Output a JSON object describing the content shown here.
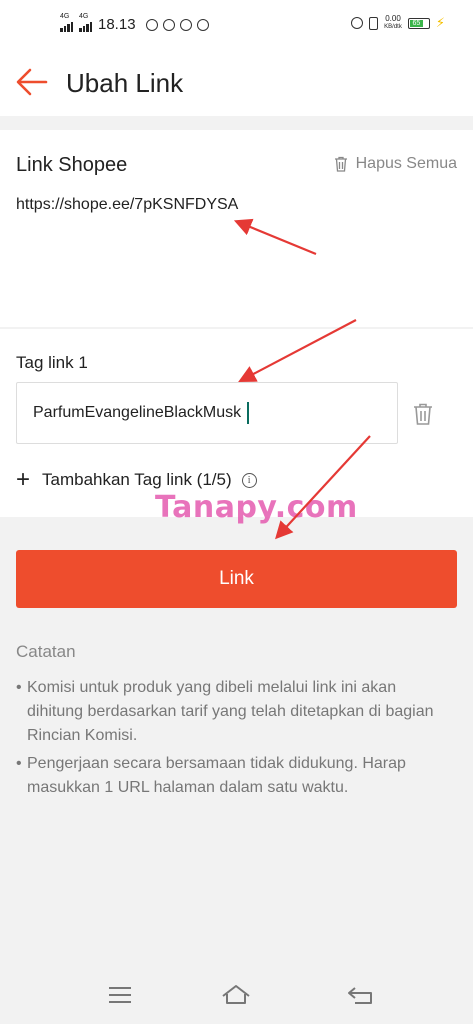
{
  "status_bar": {
    "network1": "4G",
    "network2": "4G",
    "time": "18.13",
    "speed": "0.00",
    "speed_unit": "KB/dtk",
    "battery": "65"
  },
  "header": {
    "title": "Ubah Link",
    "back_icon": "arrow-left-icon"
  },
  "link_section": {
    "label": "Link Shopee",
    "delete_all_label": "Hapus Semua",
    "url": "https://shope.ee/7pKSNFDYSA"
  },
  "tag_section": {
    "label": "Tag link 1",
    "value": "ParfumEvangelineBlackMusk",
    "add_label": "Tambahkan Tag link (1/5)"
  },
  "watermark": "Tanapy.com",
  "link_button": "Link",
  "notes": {
    "title": "Catatan",
    "items": [
      "Komisi untuk produk yang dibeli melalui link ini akan dihitung berdasarkan tarif yang telah ditetapkan di bagian Rincian Komisi.",
      "Pengerjaan secara bersamaan tidak didukung. Harap masukkan 1 URL halaman dalam satu waktu."
    ]
  },
  "colors": {
    "accent": "#ee4d2d",
    "annotation_arrow": "#e53935"
  }
}
